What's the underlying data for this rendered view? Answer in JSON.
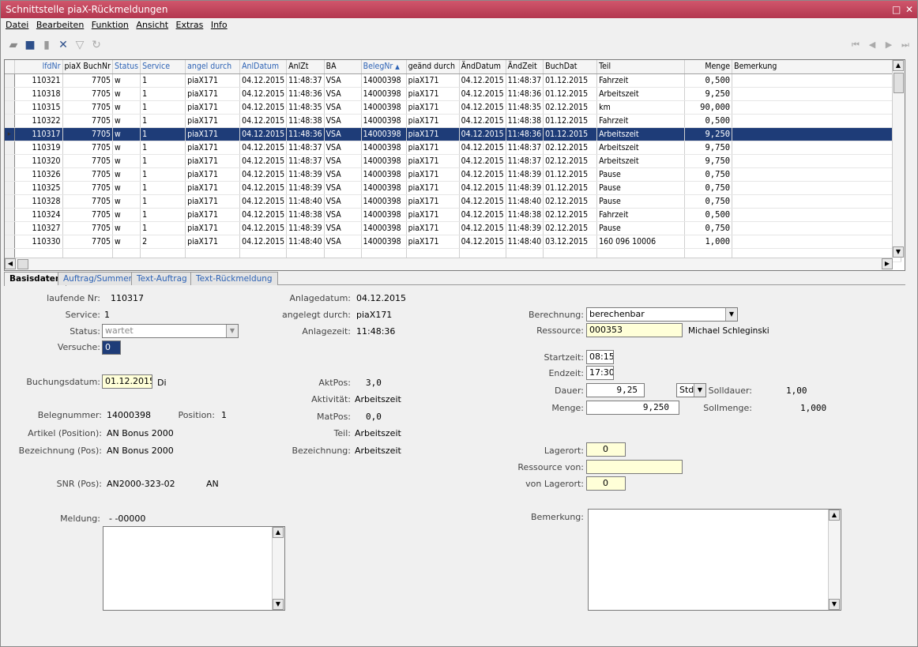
{
  "window": {
    "title": "Schnittstelle piaX-Rückmeldungen"
  },
  "menu": [
    "Datei",
    "Bearbeiten",
    "Funktion",
    "Ansicht",
    "Extras",
    "Info"
  ],
  "grid": {
    "columns": [
      "lfdNr",
      "piaX BuchNr",
      "Status",
      "Service",
      "angel durch",
      "AnlDatum",
      "AnlZt",
      "BA",
      "BelegNr",
      "geänd durch",
      "ÄndDatum",
      "ÄndZeit",
      "BuchDat",
      "Teil",
      "Menge",
      "Bemerkung"
    ],
    "rows": [
      [
        "110321",
        "7705",
        "w",
        "1",
        "piaX171",
        "04.12.2015",
        "11:48:37",
        "VSA",
        "14000398",
        "piaX171",
        "04.12.2015",
        "11:48:37",
        "01.12.2015",
        "Fahrzeit",
        "0,500",
        ""
      ],
      [
        "110318",
        "7705",
        "w",
        "1",
        "piaX171",
        "04.12.2015",
        "11:48:36",
        "VSA",
        "14000398",
        "piaX171",
        "04.12.2015",
        "11:48:36",
        "01.12.2015",
        "Arbeitszeit",
        "9,250",
        ""
      ],
      [
        "110315",
        "7705",
        "w",
        "1",
        "piaX171",
        "04.12.2015",
        "11:48:35",
        "VSA",
        "14000398",
        "piaX171",
        "04.12.2015",
        "11:48:35",
        "02.12.2015",
        "km",
        "90,000",
        ""
      ],
      [
        "110322",
        "7705",
        "w",
        "1",
        "piaX171",
        "04.12.2015",
        "11:48:38",
        "VSA",
        "14000398",
        "piaX171",
        "04.12.2015",
        "11:48:38",
        "01.12.2015",
        "Fahrzeit",
        "0,500",
        ""
      ],
      [
        "110317",
        "7705",
        "w",
        "1",
        "piaX171",
        "04.12.2015",
        "11:48:36",
        "VSA",
        "14000398",
        "piaX171",
        "04.12.2015",
        "11:48:36",
        "01.12.2015",
        "Arbeitszeit",
        "9,250",
        ""
      ],
      [
        "110319",
        "7705",
        "w",
        "1",
        "piaX171",
        "04.12.2015",
        "11:48:37",
        "VSA",
        "14000398",
        "piaX171",
        "04.12.2015",
        "11:48:37",
        "02.12.2015",
        "Arbeitszeit",
        "9,750",
        ""
      ],
      [
        "110320",
        "7705",
        "w",
        "1",
        "piaX171",
        "04.12.2015",
        "11:48:37",
        "VSA",
        "14000398",
        "piaX171",
        "04.12.2015",
        "11:48:37",
        "02.12.2015",
        "Arbeitszeit",
        "9,750",
        ""
      ],
      [
        "110326",
        "7705",
        "w",
        "1",
        "piaX171",
        "04.12.2015",
        "11:48:39",
        "VSA",
        "14000398",
        "piaX171",
        "04.12.2015",
        "11:48:39",
        "01.12.2015",
        "Pause",
        "0,750",
        ""
      ],
      [
        "110325",
        "7705",
        "w",
        "1",
        "piaX171",
        "04.12.2015",
        "11:48:39",
        "VSA",
        "14000398",
        "piaX171",
        "04.12.2015",
        "11:48:39",
        "01.12.2015",
        "Pause",
        "0,750",
        ""
      ],
      [
        "110328",
        "7705",
        "w",
        "1",
        "piaX171",
        "04.12.2015",
        "11:48:40",
        "VSA",
        "14000398",
        "piaX171",
        "04.12.2015",
        "11:48:40",
        "02.12.2015",
        "Pause",
        "0,750",
        ""
      ],
      [
        "110324",
        "7705",
        "w",
        "1",
        "piaX171",
        "04.12.2015",
        "11:48:38",
        "VSA",
        "14000398",
        "piaX171",
        "04.12.2015",
        "11:48:38",
        "02.12.2015",
        "Fahrzeit",
        "0,500",
        ""
      ],
      [
        "110327",
        "7705",
        "w",
        "1",
        "piaX171",
        "04.12.2015",
        "11:48:39",
        "VSA",
        "14000398",
        "piaX171",
        "04.12.2015",
        "11:48:39",
        "02.12.2015",
        "Pause",
        "0,750",
        ""
      ],
      [
        "110330",
        "7705",
        "w",
        "2",
        "piaX171",
        "04.12.2015",
        "11:48:40",
        "VSA",
        "14000398",
        "piaX171",
        "04.12.2015",
        "11:48:40",
        "03.12.2015",
        "160 096 10006",
        "1,000",
        ""
      ]
    ],
    "selected_index": 4
  },
  "tabs": [
    "Basisdaten",
    "Auftrag/Summen",
    "Text-Auftrag",
    "Text-Rückmeldung"
  ],
  "form": {
    "lfd_label": "laufende Nr:",
    "lfd": "110317",
    "service_label": "Service:",
    "service": "1",
    "status_label": "Status:",
    "status": "wartet",
    "versuche_label": "Versuche:",
    "versuche": "0",
    "buchungsdatum_label": "Buchungsdatum:",
    "buchungsdatum": "01.12.2015",
    "wochentag": "Di",
    "belegnummer_label": "Belegnummer:",
    "belegnummer": "14000398",
    "position_label": "Position:",
    "position": "1",
    "artikel_label": "Artikel (Position):",
    "artikel": "AN Bonus 2000",
    "bezeichnung_pos_label": "Bezeichnung (Pos):",
    "bezeichnung_pos": "AN Bonus 2000",
    "snr_label": "SNR (Pos):",
    "snr": "AN2000-323-02",
    "snr_suffix": "AN",
    "meldung_label": "Meldung:",
    "meldung": "-  -00000",
    "anlagedatum_label": "Anlagedatum:",
    "anlagedatum": "04.12.2015",
    "angelegt_label": "angelegt durch:",
    "angelegt": "piaX171",
    "anlagezeit_label": "Anlagezeit:",
    "anlagezeit": "11:48:36",
    "aktpos_label": "AktPos:",
    "aktpos": "3,0",
    "aktivitaet_label": "Aktivität:",
    "aktivitaet": "Arbeitszeit",
    "matpos_label": "MatPos:",
    "matpos": "0,0",
    "teil_label": "Teil:",
    "teil": "Arbeitszeit",
    "bezeichnung_label": "Bezeichnung:",
    "bezeichnung": "Arbeitszeit",
    "berechnung_label": "Berechnung:",
    "berechnung": "berechenbar",
    "ressource_label": "Ressource:",
    "ressource": "000353",
    "ressource_name": "Michael Schleginski",
    "startzeit_label": "Startzeit:",
    "startzeit": "08:15",
    "endzeit_label": "Endzeit:",
    "endzeit": "17:30",
    "dauer_label": "Dauer:",
    "dauer": "9,25",
    "einheit": "Std",
    "solldauer_label": "Solldauer:",
    "solldauer": "1,00",
    "menge_label": "Menge:",
    "menge": "9,250",
    "sollmenge_label": "Sollmenge:",
    "sollmenge": "1,000",
    "lagerort_label": "Lagerort:",
    "lagerort": "0",
    "ressource_von_label": "Ressource von:",
    "ressource_von": "",
    "von_lagerort_label": "von Lagerort:",
    "von_lagerort": "0",
    "bemerkung_label": "Bemerkung:"
  }
}
